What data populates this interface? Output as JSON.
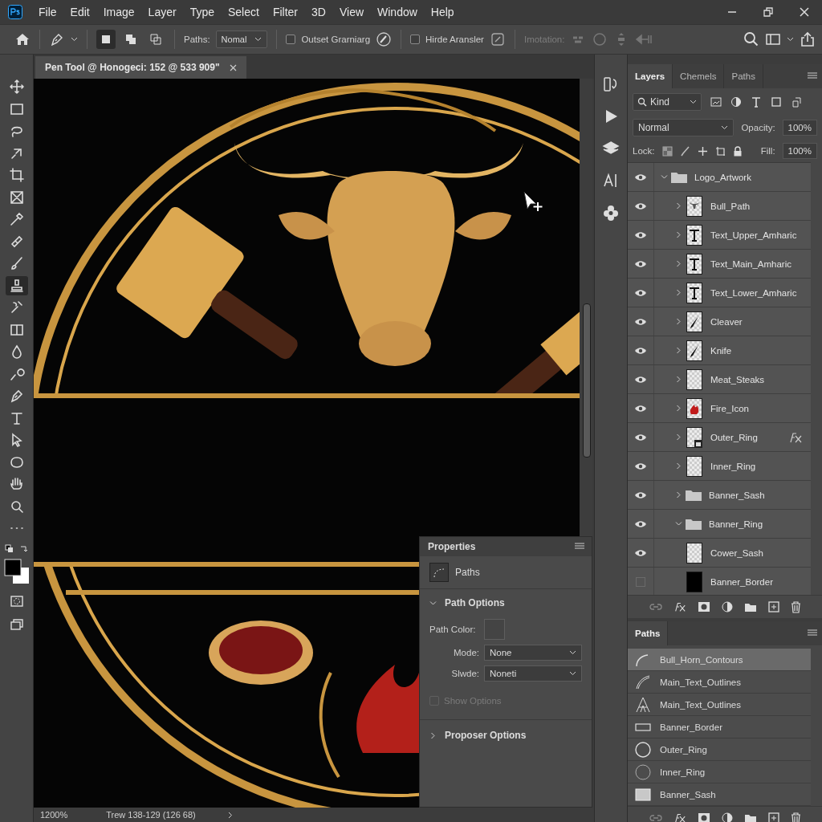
{
  "menu": {
    "items": [
      "File",
      "Edit",
      "Image",
      "Layer",
      "Type",
      "Select",
      "Filter",
      "3D",
      "View",
      "Window",
      "Help"
    ]
  },
  "options_bar": {
    "shape_modes": [
      {
        "selected": true
      },
      {
        "selected": false
      },
      {
        "selected": false
      }
    ],
    "paths_label": "Paths:",
    "paths_value": "Nomal",
    "checkboxes": [
      {
        "label": "Outset Grarniarg",
        "checked": false
      },
      {
        "label": "Hirde Aransler",
        "checked": false
      }
    ],
    "imotation": {
      "label": "Imotation:",
      "disabled": true
    }
  },
  "tools": [
    {
      "selected": false
    },
    {
      "selected": false
    },
    {
      "selected": false
    },
    {
      "selected": false
    },
    {
      "selected": false
    },
    {
      "selected": false
    },
    {
      "selected": false
    },
    {
      "selected": false
    },
    {
      "selected": false
    },
    {
      "selected": true
    },
    {
      "selected": false
    },
    {
      "selected": false
    },
    {
      "selected": false
    },
    {
      "selected": false
    },
    {
      "selected": false
    },
    {
      "selected": false
    },
    {
      "selected": false
    },
    {
      "selected": false
    },
    {
      "selected": false
    },
    {
      "selected": false
    },
    {
      "selected": false
    }
  ],
  "document": {
    "tab_title": "Pen Tool @ Honogeci: 152 @ 533 909\"",
    "zoom": "1200%",
    "status": "Trew 138-129 (126 68)"
  },
  "properties": {
    "title": "Properties",
    "type_label": "Paths",
    "path_options": {
      "title": "Path Options",
      "expanded": true,
      "path_color_label": "Path Color:",
      "fields": [
        {
          "label": "Mode:",
          "value": "None"
        },
        {
          "label": "Slwde:",
          "value": "Noneti"
        }
      ],
      "show_options": {
        "label": "Show Options",
        "checked": false,
        "disabled": true
      }
    },
    "proposer_options": {
      "title": "Proposer Options",
      "expanded": false
    }
  },
  "layers_panel": {
    "tabs": [
      {
        "label": "Layers",
        "selected": true
      },
      {
        "label": "Chemels",
        "selected": false
      },
      {
        "label": "Paths",
        "selected": false
      }
    ],
    "filter": "Kind",
    "blend_mode": "Normal",
    "opacity_label": "Opacity:",
    "opacity": "100%",
    "lock_label": "Lock:",
    "fill_label": "Fill:",
    "fill": "100%",
    "layers": [
      {
        "name": "Logo_Artwork",
        "kind": "folder",
        "visible": true,
        "expanded": true,
        "children": [
          {
            "name": "Bull_Path",
            "kind": "bull",
            "visible": true,
            "expanded": false
          },
          {
            "name": "Text_Upper_Amharic",
            "kind": "text",
            "visible": true,
            "expanded": false
          },
          {
            "name": "Text_Main_Amharic",
            "kind": "text",
            "visible": true,
            "expanded": false
          },
          {
            "name": "Text_Lower_Amharic",
            "kind": "text",
            "visible": true,
            "expanded": false
          },
          {
            "name": "Cleaver",
            "kind": "blade",
            "visible": true,
            "expanded": false
          },
          {
            "name": "Knife",
            "kind": "blade",
            "visible": true,
            "expanded": false
          },
          {
            "name": "Meat_Steaks",
            "kind": "pixel",
            "visible": true,
            "expanded": false
          },
          {
            "name": "Fire_Icon",
            "kind": "fire",
            "visible": true,
            "expanded": false
          },
          {
            "name": "Outer_Ring",
            "kind": "smart",
            "visible": true,
            "expanded": false,
            "effects": true
          },
          {
            "name": "Inner_Ring",
            "kind": "pixel",
            "visible": true,
            "expanded": false
          },
          {
            "name": "Banner_Sash",
            "kind": "folder",
            "visible": true,
            "expanded": false
          },
          {
            "name": "Banner_Ring",
            "kind": "folder",
            "visible": true,
            "expanded": true,
            "children": [
              {
                "name": "Cower_Sash",
                "kind": "pixel",
                "visible": true
              },
              {
                "name": "Banner_Border",
                "kind": "fill",
                "visible": false
              }
            ]
          }
        ]
      }
    ]
  },
  "paths_panel": {
    "title": "Paths",
    "paths": [
      {
        "name": "Bull_Horn_Contours",
        "kind": "curve",
        "selected": true
      },
      {
        "name": "Main_Text_Outlines",
        "kind": "stroke",
        "selected": false
      },
      {
        "name": "Main_Text_Outlines",
        "kind": "text",
        "selected": false
      },
      {
        "name": "Banner_Border",
        "kind": "rect",
        "selected": false
      },
      {
        "name": "Outer_Ring",
        "kind": "circle",
        "selected": false
      },
      {
        "name": "Inner_Ring",
        "kind": "circle-thin",
        "selected": false
      },
      {
        "name": "Banner_Sash",
        "kind": "sash",
        "selected": false
      }
    ]
  }
}
